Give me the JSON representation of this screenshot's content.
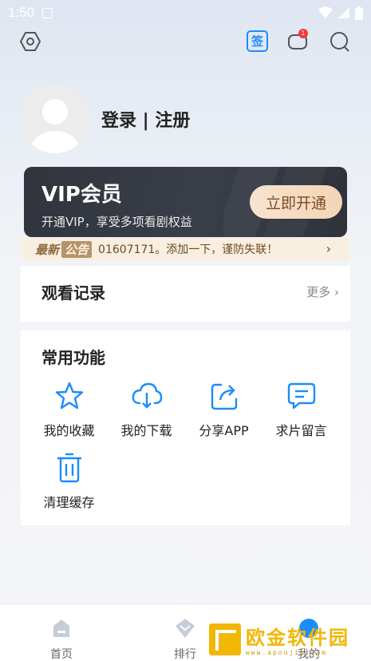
{
  "status_bar": {
    "time": "1:50"
  },
  "top_bar": {
    "sign_label": "签",
    "notice_badge": "1"
  },
  "profile": {
    "login_text": "登录 | 注册"
  },
  "vip": {
    "title": "VIP会员",
    "subtitle": "开通VIP，享受多项看剧权益",
    "button": "立即开通"
  },
  "notice": {
    "label_prefix": "最新",
    "label_tag": "公告",
    "text": "01607171。添加一下，谨防失联！",
    "arrow": "›"
  },
  "history": {
    "title": "观看记录",
    "more": "更多 ›"
  },
  "functions": {
    "title": "常用功能",
    "items": [
      {
        "label": "我的收藏",
        "icon": "star-icon"
      },
      {
        "label": "我的下载",
        "icon": "cloud-download-icon"
      },
      {
        "label": "分享APP",
        "icon": "share-icon"
      },
      {
        "label": "求片留言",
        "icon": "message-icon"
      },
      {
        "label": "清理缓存",
        "icon": "trash-icon"
      }
    ]
  },
  "tabs": [
    {
      "label": "首页",
      "icon": "home-icon"
    },
    {
      "label": "排行",
      "icon": "rank-icon"
    },
    {
      "label": "我的",
      "icon": "profile-icon"
    }
  ],
  "watermark": {
    "text": "欧金软件园",
    "url": "www.apoujin.com"
  },
  "colors": {
    "accent": "#1a8cff",
    "vip_bg": "#30343d",
    "vip_button": "#f3d5b5",
    "notice_bg": "#f9efe0"
  }
}
